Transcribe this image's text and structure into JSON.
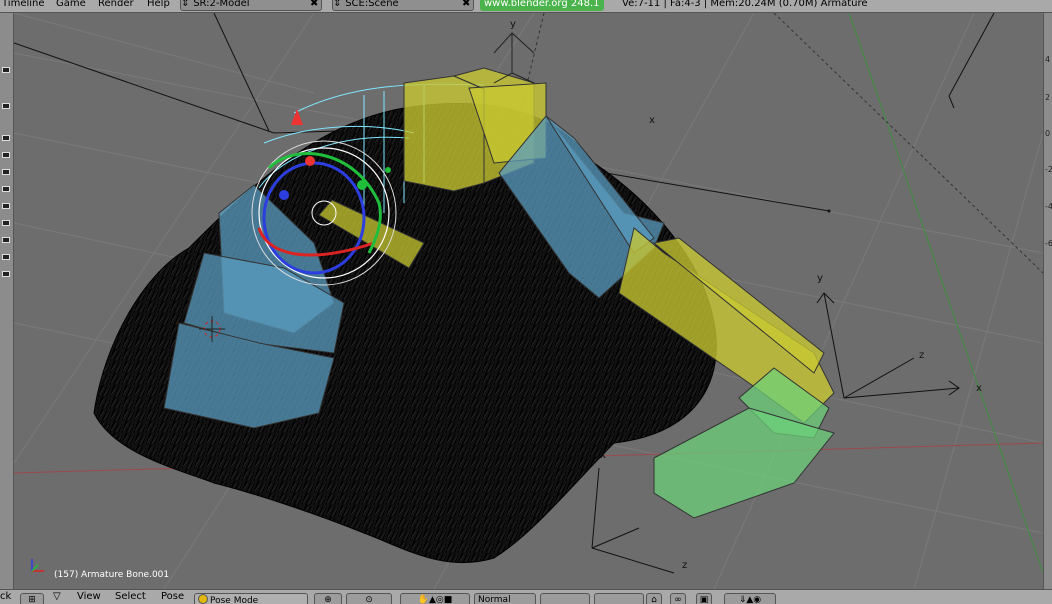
{
  "top_menu": {
    "items": [
      "Timeline",
      "Game",
      "Render",
      "Help"
    ],
    "screen": "SR:2-Model",
    "scene": "SCE:Scene",
    "version_badge": "www.blender.org 248.1",
    "stats": "Ve:7-11 | Fa:4-3 | Mem:20.24M (0.70M) Armature"
  },
  "viewport": {
    "status_text": "(157) Armature Bone.001",
    "axis_labels": {
      "x": "x",
      "y": "y",
      "z": "z"
    },
    "right_ruler": [
      "4",
      "2",
      "0",
      "-2",
      "-4",
      "-6"
    ]
  },
  "bottom_bar": {
    "editor_type_icon": "grid-icon",
    "menus": [
      "View",
      "Select",
      "Pose"
    ],
    "mode": "Pose Mode",
    "orientation": "Normal",
    "cropped_left_text": "ck"
  },
  "colors": {
    "bone_yellow": "#c8c832",
    "bone_blue": "#5a9cc0",
    "bone_green": "#6cd27a",
    "selection_cyan": "#7fe8ff",
    "header_gray": "#a9a9a9"
  }
}
